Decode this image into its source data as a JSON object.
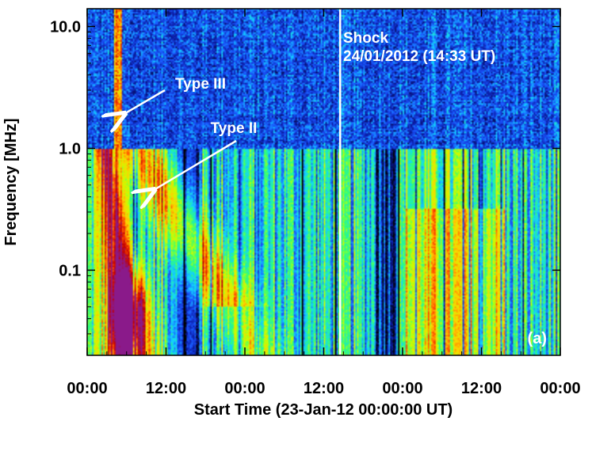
{
  "chart_data": {
    "type": "heatmap",
    "title": "",
    "xlabel": "Start Time (23-Jan-12 00:00:00 UT)",
    "ylabel": "Frequency [MHz]",
    "yscale": "log",
    "x_range_hours": [
      0,
      72
    ],
    "ylim": [
      0.02,
      14
    ],
    "x_tick_labels": [
      "00:00",
      "12:00",
      "00:00",
      "12:00",
      "00:00",
      "12:00",
      "00:00"
    ],
    "x_ticks_hours": [
      0,
      12,
      24,
      36,
      48,
      60,
      72
    ],
    "y_ticks": [
      {
        "value": 10.0,
        "label": "10.0"
      },
      {
        "value": 1.0,
        "label": "1.0"
      },
      {
        "value": 0.1,
        "label": "0.1"
      }
    ],
    "colormap": [
      "#000000",
      "#0a1aa0",
      "#1a55ff",
      "#13d3ff",
      "#2dff7a",
      "#c8ff00",
      "#ffd000",
      "#ff4a00",
      "#c00000",
      "#8a1a8a"
    ],
    "annotations": {
      "type3": {
        "text": "Type III",
        "arrow_to": {
          "hours": 5.5,
          "mhz": 1.9
        }
      },
      "type2": {
        "text": "Type II",
        "arrow_to": {
          "hours": 10.0,
          "mhz": 0.45
        }
      },
      "shock_line": {
        "hours": 38.5,
        "label_line1": "Shock",
        "label_line2": "24/01/2012 (14:33 UT)"
      }
    },
    "panel_label": "(a)",
    "colors": {
      "shock_line": "#ffffff",
      "annotation_text": "#ffffff"
    }
  }
}
